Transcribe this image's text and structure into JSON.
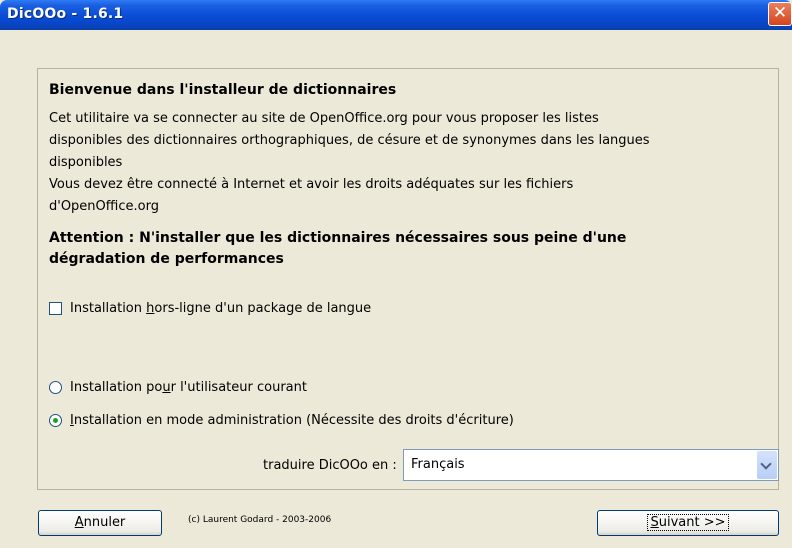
{
  "window": {
    "title": "DicOOo - 1.6.1"
  },
  "heading": "Bienvenue dans l'installeur de dictionnaires",
  "description": [
    "Cet utilitaire va se connecter au site de OpenOffice.org pour vous proposer les listes",
    "disponibles des dictionnaires orthographiques, de césure et de synonymes dans les langues",
    "disponibles",
    "Vous devez être connecté à Internet et avoir les droits adéquates sur les fichiers",
    "d'OpenOffice.org"
  ],
  "warning": [
    "Attention : N'installer que les dictionnaires nécessaires sous peine d'une",
    "dégradation de performances"
  ],
  "offline_checkbox": {
    "label_pre": "Installation ",
    "label_mnemonic": "h",
    "label_post": "ors-ligne d'un package de langue",
    "checked": false
  },
  "radio_user": {
    "label_pre": "Installation po",
    "label_mnemonic": "u",
    "label_post": "r l'utilisateur courant",
    "selected": false
  },
  "radio_admin": {
    "label_pre": "",
    "label_mnemonic": "I",
    "label_post": "nstallation en mode administration (Nécessite des droits d'écriture)",
    "selected": true
  },
  "translate": {
    "label": "traduire DicOOo en :",
    "value": "Français"
  },
  "buttons": {
    "cancel": {
      "mnemonic": "A",
      "rest": "nnuler"
    },
    "next": {
      "mnemonic": "S",
      "rest": "uivant >>"
    }
  },
  "credit": "(c) Laurent Godard - 2003-2006"
}
